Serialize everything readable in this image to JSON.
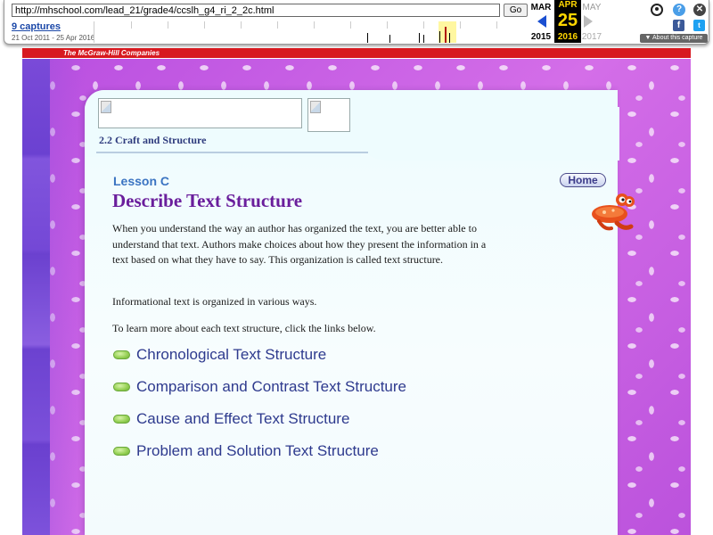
{
  "wayback": {
    "url": "http://mhschool.com/lead_21/grade4/ccslh_g4_ri_2_2c.html",
    "go_label": "Go",
    "captures_label": "9 captures",
    "date_range": "21 Oct 2011 - 25 Apr 2016",
    "months": {
      "prev": "MAR",
      "current": "APR",
      "next": "MAY"
    },
    "day": "25",
    "years": {
      "prev": "2015",
      "current": "2016",
      "next": "2017"
    },
    "about_label": "▼ About this capture",
    "facebook_glyph": "f",
    "twitter_glyph": "t",
    "help_glyph": "?",
    "close_glyph": "✕",
    "icons": [
      "user-icon",
      "help-icon",
      "close-icon",
      "facebook-icon",
      "twitter-icon"
    ]
  },
  "publisher": {
    "label": "The McGraw-Hill Companies",
    "color": "#d71920"
  },
  "page": {
    "section_title": "2.2 Craft and Structure",
    "lesson_label": "Lesson C",
    "lesson_title": "Describe Text Structure",
    "home_label": "Home",
    "intro_paragraph": "When you understand the way an author has organized the text, you are better able to understand that text. Authors make choices about how they present the information in a text based on what they have to say. This organization is called text structure.",
    "info_paragraph": "Informational text is organized in various ways.",
    "learn_paragraph": "To learn more about each text structure, click the links below.",
    "links": [
      {
        "label": "Chronological Text Structure"
      },
      {
        "label": "Comparison and Contrast Text Structure"
      },
      {
        "label": "Cause and Effect Text Structure"
      },
      {
        "label": "Problem and Solution Text Structure"
      }
    ]
  },
  "colors": {
    "background_purple": "#c456e0",
    "title_purple": "#6a1e9c",
    "lesson_blue": "#3b74c2",
    "link_blue": "#2e3a8e",
    "panel": "#eefcfe"
  }
}
